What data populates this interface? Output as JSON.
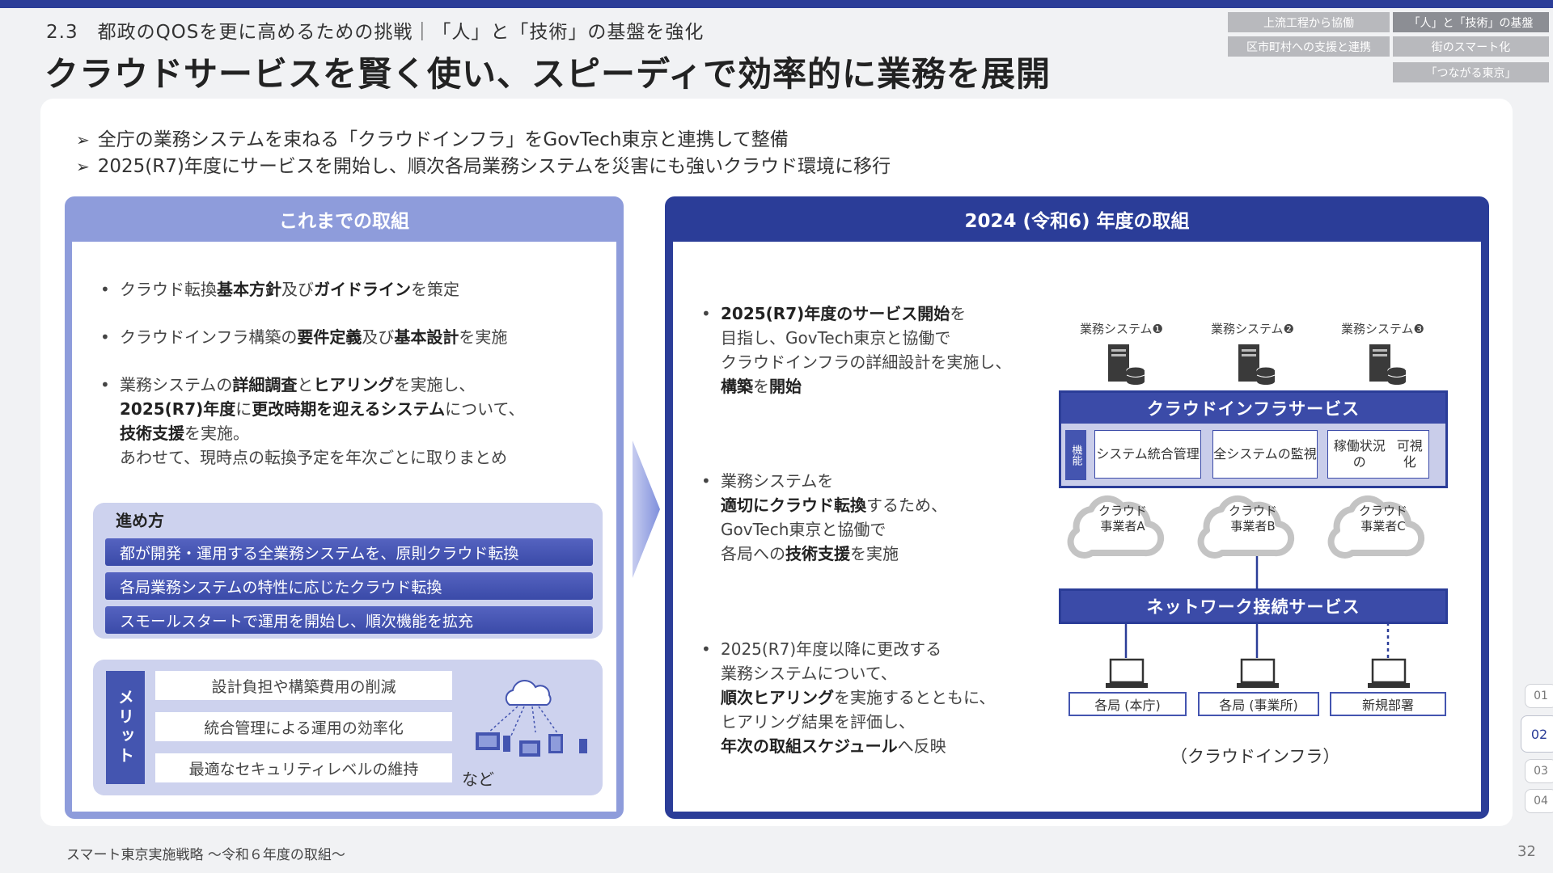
{
  "header": {
    "section": "2.3　都政のQOSを更に高めるための挑戦｜「人」と「技術」の基盤を強化",
    "title": "クラウドサービスを賢く使い、スピーディで効率的に業務を展開"
  },
  "top_nav": [
    {
      "label": "上流工程から協働",
      "active": false
    },
    {
      "label": "「人」と「技術」の基盤",
      "active": true
    },
    {
      "label": "区市町村への支援と連携",
      "active": false
    },
    {
      "label": "街のスマート化",
      "active": false
    },
    {
      "label": "「つながる東京」",
      "active": false
    }
  ],
  "intro": [
    "全庁の業務システムを束ねる「クラウドインフラ」をGovTech東京と連携して整備",
    "2025(R7)年度にサービスを開始し、順次各局業務システムを災害にも強いクラウド環境に移行"
  ],
  "left": {
    "header": "これまでの取組",
    "b1": {
      "t1": "クラウド転換",
      "b1": "基本方針",
      "t2": "及び",
      "b2": "ガイドライン",
      "t3": "を策定"
    },
    "b2": {
      "t1": "クラウドインフラ構築の",
      "b1": "要件定義",
      "t2": "及び",
      "b2": "基本設計",
      "t3": "を実施"
    },
    "b3": {
      "l1a": "業務システムの",
      "l1b": "詳細調査",
      "l1c": "と",
      "l1d": "ヒアリング",
      "l1e": "を実施し、",
      "l2a": "2025(R7)年度",
      "l2b": "に",
      "l2c": "更改時期を迎えるシステム",
      "l2d": "について、",
      "l3a": "技術支援",
      "l3b": "を実施。",
      "l4": "あわせて、現時点の転換予定を年次ごとに取りまとめ"
    },
    "steps_title": "進め方",
    "steps": [
      "都が開発・運用する全業務システムを、原則クラウド転換",
      "各局業務システムの特性に応じたクラウド転換",
      "スモールスタートで運用を開始し、順次機能を拡充"
    ],
    "merit_label": "メリット",
    "merits": [
      "設計負担や構築費用の削減",
      "統合管理による運用の効率化",
      "最適なセキュリティレベルの維持"
    ],
    "nado": "など"
  },
  "right": {
    "header": "2024 (令和6) 年度の取組",
    "b1": {
      "l1a": "2025(R7)年度のサービス開始",
      "l1b": "を",
      "l2": "目指し、GovTech東京と協働で",
      "l3": "クラウドインフラの詳細設計を実施し、",
      "l4a": "構築",
      "l4b": "を",
      "l4c": "開始"
    },
    "b2": {
      "l1": "業務システムを",
      "l2a": "適切にクラウド転換",
      "l2b": "するため、",
      "l3": "GovTech東京と協働で",
      "l4a": "各局への",
      "l4b": "技術支援",
      "l4c": "を実施"
    },
    "b3": {
      "l1": "2025(R7)年度以降に更改する",
      "l2": "業務システムについて、",
      "l3a": "順次ヒアリング",
      "l3b": "を実施するとともに、",
      "l4": "ヒアリング結果を評価し、",
      "l5a": "年次の取組スケジュール",
      "l5b": "へ反映"
    }
  },
  "diagram": {
    "systems": [
      "業務システム❶",
      "業務システム❷",
      "業務システム❸"
    ],
    "cloud_infra_service": "クラウドインフラサービス",
    "kinou": "機能",
    "functions": [
      {
        "l1": "システム",
        "l2": "統合管理"
      },
      {
        "l1": "全システムの",
        "l2": "監視"
      },
      {
        "l1": "稼働状況の",
        "l2": "可視化"
      }
    ],
    "clouds": [
      {
        "l1": "クラウド",
        "l2": "事業者A"
      },
      {
        "l1": "クラウド",
        "l2": "事業者B"
      },
      {
        "l1": "クラウド",
        "l2": "事業者C"
      }
    ],
    "network_service": "ネットワーク接続サービス",
    "offices": [
      "各局 (本庁)",
      "各局 (事業所)",
      "新規部署"
    ],
    "caption": "（クラウドインフラ）"
  },
  "page_nav": [
    "01",
    "02",
    "03",
    "04"
  ],
  "footer": "スマート東京実施戦略 ～令和６年度の取組～",
  "page_number": "32",
  "colors": {
    "primary": "#2b3d98",
    "light": "#8e9cdb",
    "pale": "#cdd2ee"
  }
}
